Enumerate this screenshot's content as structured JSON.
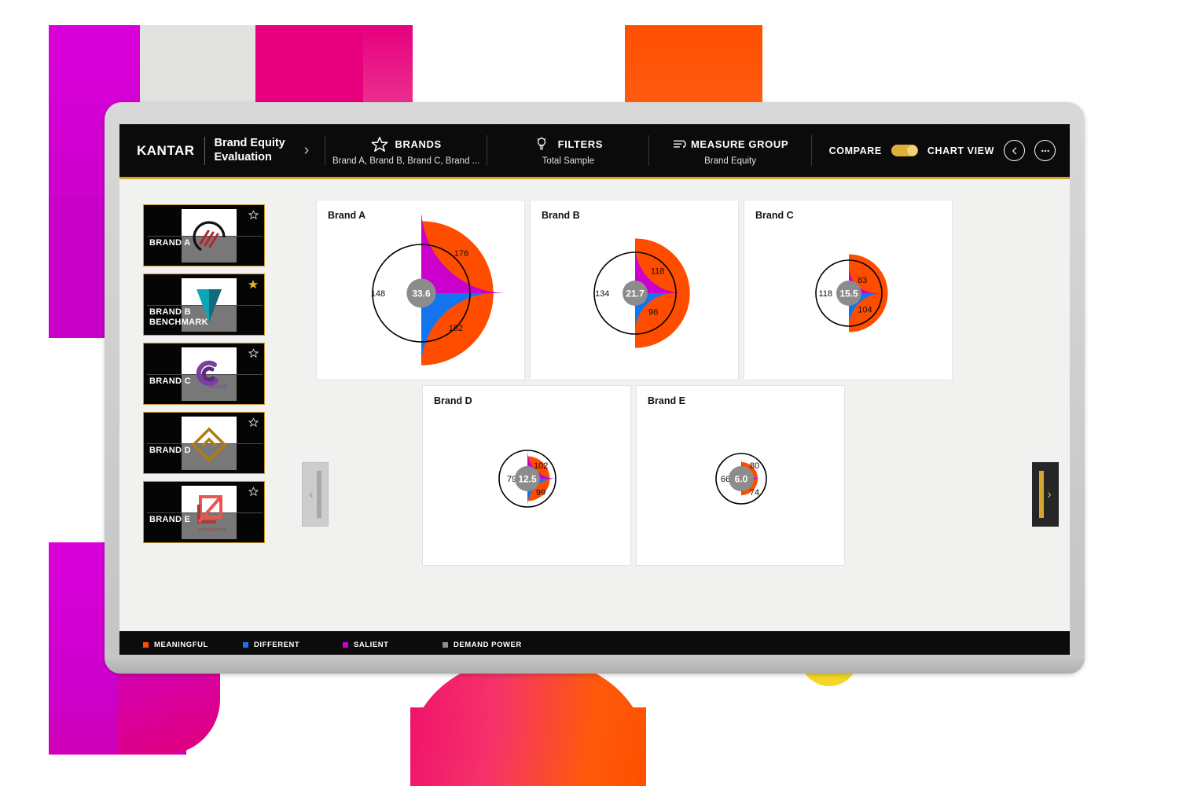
{
  "header": {
    "logo": "KANTAR",
    "app_title": "Brand Equity\nEvaluation",
    "chevron": "›",
    "brands": {
      "label": "BRANDS",
      "sub": "Brand A, Brand B, Brand C, Brand ...",
      "icon": "star-icon"
    },
    "filters": {
      "label": "FILTERS",
      "sub": "Total Sample",
      "icon": "bulb-icon"
    },
    "measure_group": {
      "label": "MEASURE GROUP",
      "sub": "Brand Equity",
      "icon": "measure-icon"
    },
    "compare_label": "COMPARE",
    "chartview_label": "CHART VIEW",
    "toggle_state": "on",
    "back_icon": "←",
    "more_icon": "⋯"
  },
  "sidebar": {
    "items": [
      {
        "name": "BRAND A",
        "favorite": false,
        "logo_color": "#1d1d1d",
        "logo_accent": "#b2262e"
      },
      {
        "name": "BRAND B\nBENCHMARK",
        "favorite": true,
        "logo_color": "#0aa6b8",
        "logo_accent": "#126b78"
      },
      {
        "name": "BRAND C",
        "favorite": false,
        "logo_color": "#7b3fa0",
        "logo_accent": "#5d2c7d",
        "sublabel": "BRAND"
      },
      {
        "name": "BRAND D",
        "favorite": false,
        "logo_color": "#b27a12",
        "logo_accent": "#8a5d0b"
      },
      {
        "name": "BRAND E",
        "favorite": false,
        "logo_color": "#e8564f",
        "logo_accent": "#a83b36",
        "sublabel": "COMPANY"
      }
    ]
  },
  "nav": {
    "prev_label": "‹",
    "next_label": "›",
    "prev_enabled": false,
    "next_enabled": true
  },
  "colors": {
    "meaningful": "#ff4d00",
    "different": "#1374f0",
    "salient": "#cc00cc",
    "demand_power": "#8c8c8c",
    "reference_circle": "#000000",
    "accent_gold": "#d6a528",
    "topbar_bg": "#0b0b0b"
  },
  "legend": [
    {
      "label": "MEANINGFUL",
      "color": "#ff4d00"
    },
    {
      "label": "DIFFERENT",
      "color": "#1374f0"
    },
    {
      "label": "SALIENT",
      "color": "#cc00cc"
    },
    {
      "label": "DEMAND POWER",
      "color": "#8c8c8c"
    }
  ],
  "chart_data": {
    "type": "pie",
    "title": "Brand Equity Evaluation",
    "subtitle": "Total Sample",
    "chart_style": "radial rose / nightingale gauge per brand",
    "reference_value": 100,
    "reference_note": "black circle marks index = 100",
    "scale_note": "wedge radius proportional to index value",
    "wedges": [
      {
        "name": "MEANINGFUL",
        "color": "#ff4d00",
        "start_angle_deg": 90,
        "sweep_deg": 180
      },
      {
        "name": "SALIENT",
        "color": "#cc00cc",
        "start_angle_deg": 0,
        "sweep_deg": 90
      },
      {
        "name": "DIFFERENT",
        "color": "#1374f0",
        "start_angle_deg": 270,
        "sweep_deg": 90
      }
    ],
    "center_metric": "DEMAND POWER",
    "categories": [
      "MEANINGFUL",
      "DIFFERENT",
      "SALIENT",
      "DEMAND POWER"
    ],
    "series": [
      {
        "name": "Brand A",
        "meaningful": 148,
        "different": 152,
        "salient": 176,
        "demand_power": 33.6
      },
      {
        "name": "Brand B",
        "meaningful": 134,
        "different": 96,
        "salient": 118,
        "demand_power": 21.7
      },
      {
        "name": "Brand C",
        "meaningful": 118,
        "different": 104,
        "salient": 83,
        "demand_power": 15.5
      },
      {
        "name": "Brand D",
        "meaningful": 79,
        "different": 99,
        "salient": 102,
        "demand_power": 12.5
      },
      {
        "name": "Brand E",
        "meaningful": 66,
        "different": 74,
        "salient": 80,
        "demand_power": 6.0
      }
    ]
  },
  "charts": [
    {
      "title": "Brand A",
      "meaningful": 148,
      "different": 152,
      "salient": 176,
      "demand_power": "33.6"
    },
    {
      "title": "Brand B",
      "meaningful": 134,
      "different": 96,
      "salient": 118,
      "demand_power": "21.7"
    },
    {
      "title": "Brand C",
      "meaningful": 118,
      "different": 104,
      "salient": 83,
      "demand_power": "15.5"
    },
    {
      "title": "Brand D",
      "meaningful": 79,
      "different": 99,
      "salient": 102,
      "demand_power": "12.5"
    },
    {
      "title": "Brand E",
      "meaningful": 66,
      "different": 74,
      "salient": 80,
      "demand_power": "6.0"
    }
  ]
}
